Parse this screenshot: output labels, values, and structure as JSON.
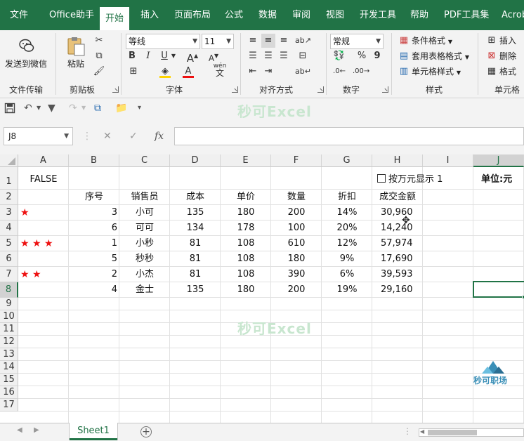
{
  "menu": {
    "items": [
      {
        "label": "文件"
      },
      {
        "label": "Office助手"
      },
      {
        "label": "开始",
        "active": true
      },
      {
        "label": "插入"
      },
      {
        "label": "页面布局"
      },
      {
        "label": "公式"
      },
      {
        "label": "数据"
      },
      {
        "label": "审阅"
      },
      {
        "label": "视图"
      },
      {
        "label": "开发工具"
      },
      {
        "label": "帮助"
      },
      {
        "label": "PDF工具集"
      },
      {
        "label": "Acrob"
      }
    ]
  },
  "ribbon": {
    "groups": {
      "file_transfer": "文件传输",
      "clipboard": "剪贴板",
      "font": "字体",
      "alignment": "对齐方式",
      "number": "数字",
      "styles": "样式",
      "cells": "单元格"
    },
    "send_to_wechat": "发送到微信",
    "paste": "粘贴",
    "font_name": "等线",
    "font_size": "11",
    "bold": "B",
    "italic": "I",
    "underline": "U",
    "font_color_letter": "A",
    "wen": "wén",
    "wen_char": "文",
    "number_format": "常规",
    "percent": "%",
    "comma": "9",
    "conditional_format": "条件格式",
    "table_format": "套用表格格式",
    "cell_styles": "单元格样式",
    "insert": "插入",
    "delete": "删除",
    "format": "格式"
  },
  "qat": {
    "watermark": "秒可Excel"
  },
  "formula_bar": {
    "name_box": "J8",
    "fx": "fx",
    "cancel": "✕",
    "enter": "✓",
    "formula": ""
  },
  "grid": {
    "columns": [
      "A",
      "B",
      "C",
      "D",
      "E",
      "F",
      "G",
      "H",
      "I",
      "J"
    ],
    "rows": [
      "1",
      "2",
      "3",
      "4",
      "5",
      "6",
      "7",
      "8",
      "9",
      "10",
      "11",
      "12",
      "13",
      "14",
      "15",
      "16",
      "17"
    ],
    "a1": "FALSE",
    "checkbox_label": "按万元显示 1",
    "unit_label": "单位:元",
    "headers": [
      "序号",
      "销售员",
      "成本",
      "单价",
      "数量",
      "折扣",
      "成交金额"
    ],
    "records": [
      {
        "stars": "★",
        "seq": "3",
        "name": "小可",
        "cost": "135",
        "price": "180",
        "qty": "200",
        "discount": "14%",
        "amount": "30,960"
      },
      {
        "stars": "",
        "seq": "6",
        "name": "可可",
        "cost": "134",
        "price": "178",
        "qty": "100",
        "discount": "20%",
        "amount": "14,240"
      },
      {
        "stars": "★ ★ ★",
        "seq": "1",
        "name": "小秒",
        "cost": "81",
        "price": "108",
        "qty": "610",
        "discount": "12%",
        "amount": "57,974"
      },
      {
        "stars": "",
        "seq": "5",
        "name": "秒秒",
        "cost": "81",
        "price": "108",
        "qty": "180",
        "discount": "9%",
        "amount": "17,690"
      },
      {
        "stars": "★ ★",
        "seq": "2",
        "name": "小杰",
        "cost": "81",
        "price": "108",
        "qty": "390",
        "discount": "6%",
        "amount": "39,593"
      },
      {
        "stars": "",
        "seq": "4",
        "name": "金士",
        "cost": "135",
        "price": "180",
        "qty": "200",
        "discount": "19%",
        "amount": "29,160"
      }
    ],
    "watermark": "秒可Excel"
  },
  "sheets": {
    "active": "Sheet1"
  },
  "logo": {
    "text": "秒可职场"
  },
  "colors": {
    "accent": "#217346",
    "star": "#e11111"
  }
}
